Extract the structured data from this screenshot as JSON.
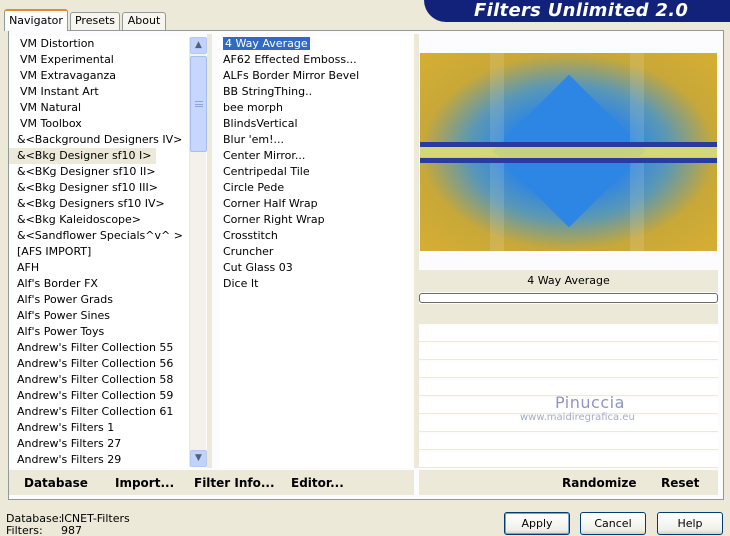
{
  "window": {
    "title": "Filters Unlimited 2.0"
  },
  "tabs": [
    {
      "label": "Navigator",
      "active": true
    },
    {
      "label": "Presets",
      "active": false
    },
    {
      "label": "About",
      "active": false
    }
  ],
  "categories": [
    "VM Distortion",
    "VM Experimental",
    "VM Extravaganza",
    "VM Instant Art",
    "VM Natural",
    "VM Toolbox",
    "&<Background Designers IV>",
    "&<Bkg Designer sf10 I>",
    "&<BKg Designer sf10 II>",
    "&<Bkg Designer sf10 III>",
    "&<Bkg Designers sf10 IV>",
    "&<Bkg Kaleidoscope>",
    "&<Sandflower Specials^v^ >",
    "[AFS IMPORT]",
    "AFH",
    "Alf's Border FX",
    "Alf's Power Grads",
    "Alf's Power Sines",
    "Alf's Power Toys",
    "Andrew's Filter Collection 55",
    "Andrew's Filter Collection 56",
    "Andrew's Filter Collection 58",
    "Andrew's Filter Collection 59",
    "Andrew's Filter Collection 61",
    "Andrew's Filters 1",
    "Andrew's Filters 27",
    "Andrew's Filters 29"
  ],
  "selected_category_index": 7,
  "filters": [
    "4 Way Average",
    "AF62 Effected Emboss...",
    "ALFs Border Mirror Bevel",
    "BB StringThing..",
    "bee morph",
    "BlindsVertical",
    "Blur 'em!...",
    "Center Mirror...",
    "Centripedal Tile",
    "Circle Pede",
    "Corner Half Wrap",
    "Corner Right Wrap",
    "Crosstitch",
    "Cruncher",
    "Cut Glass 03",
    "Dice It"
  ],
  "selected_filter_index": 0,
  "preview": {
    "filter_name": "4 Way Average",
    "colors": {
      "blue": "#2d85e4",
      "gold": "#d7ae33",
      "band_dark": "#283ca0",
      "band_light": "#d2d778"
    }
  },
  "watermark": {
    "line1": "Pinuccia",
    "line2": "www.maidiregrafica.eu"
  },
  "links": {
    "database": "Database",
    "import": "Import...",
    "filter_info": "Filter Info...",
    "editor": "Editor...",
    "randomize": "Randomize",
    "reset": "Reset"
  },
  "status": {
    "database_label": "Database:",
    "database_value": "ICNET-Filters",
    "filters_label": "Filters:",
    "filters_value": "987"
  },
  "buttons": {
    "apply": "Apply",
    "cancel": "Cancel",
    "help": "Help"
  },
  "icons": {
    "scroll_up": "triangle-up-icon",
    "scroll_down": "triangle-down-icon"
  }
}
